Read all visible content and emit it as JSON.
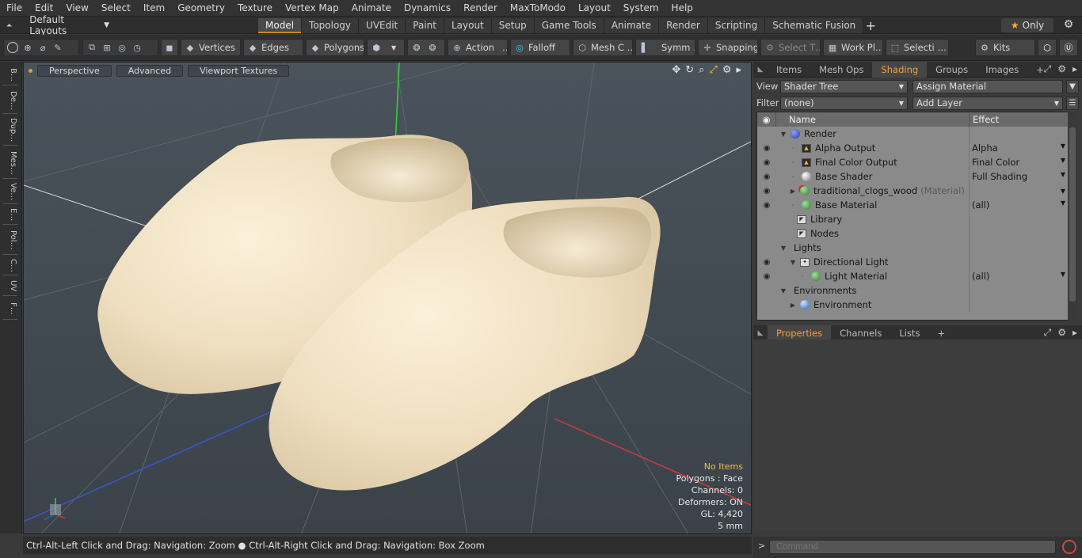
{
  "menu": [
    "File",
    "Edit",
    "View",
    "Select",
    "Item",
    "Geometry",
    "Texture",
    "Vertex Map",
    "Animate",
    "Dynamics",
    "Render",
    "MaxToModo",
    "Layout",
    "System",
    "Help"
  ],
  "layout_select": "Default Layouts",
  "tabs": [
    "Model",
    "Topology",
    "UVEdit",
    "Paint",
    "Layout",
    "Setup",
    "Game Tools",
    "Animate",
    "Render",
    "Scripting",
    "Schematic Fusion"
  ],
  "tab_add": "+",
  "only_label": "Only",
  "toolbar": {
    "vertices": "Vertices",
    "edges": "Edges",
    "polygons": "Polygons",
    "action": "Action",
    "action_more": "…",
    "falloff": "Falloff",
    "mesh": "Mesh C …",
    "symm": "Symm …",
    "snapping": "Snapping",
    "select_t": "Select T…",
    "work_pl": "Work Pl…",
    "selecti": "Selecti …",
    "kits": "Kits"
  },
  "left_tabs": [
    "B…",
    "De…",
    "Dup…",
    "Mes…",
    "Ve…",
    "E…",
    "Pol…",
    "C…",
    "UV",
    "F…"
  ],
  "viewport": {
    "perspective": "Perspective",
    "advanced": "Advanced",
    "textures": "Viewport Textures",
    "info": {
      "no_items": "No Items",
      "polygons": "Polygons : Face",
      "channels": "Channels: 0",
      "deformers": "Deformers: ON",
      "gl": "GL: 4,420",
      "scale": "5 mm"
    }
  },
  "status": {
    "hint1": "Ctrl-Alt-Left Click and Drag: Navigation: Zoom",
    "hint2": "Ctrl-Alt-Right Click and Drag: Navigation: Box Zoom"
  },
  "panel_tabs": [
    "Items",
    "Mesh Ops",
    "Shading",
    "Groups",
    "Images"
  ],
  "panel_add": "+",
  "view_label": "View",
  "view_value": "Shader Tree",
  "assign_material": "Assign Material",
  "filter_label": "Filter",
  "filter_value": "(none)",
  "add_layer": "Add Layer",
  "tree": {
    "col_name": "Name",
    "col_effect": "Effect",
    "rows": [
      {
        "name": "Render",
        "effect": "",
        "suffix": ""
      },
      {
        "name": "Alpha Output",
        "effect": "Alpha",
        "suffix": ""
      },
      {
        "name": "Final Color Output",
        "effect": "Final Color",
        "suffix": ""
      },
      {
        "name": "Base Shader",
        "effect": "Full Shading",
        "suffix": ""
      },
      {
        "name": "traditional_clogs_wood",
        "effect": "",
        "suffix": "(Material)"
      },
      {
        "name": "Base Material",
        "effect": "(all)",
        "suffix": ""
      },
      {
        "name": "Library",
        "effect": "",
        "suffix": ""
      },
      {
        "name": "Nodes",
        "effect": "",
        "suffix": ""
      },
      {
        "name": "Lights",
        "effect": "",
        "suffix": ""
      },
      {
        "name": "Directional Light",
        "effect": "",
        "suffix": ""
      },
      {
        "name": "Light Material",
        "effect": "(all)",
        "suffix": ""
      },
      {
        "name": "Environments",
        "effect": "",
        "suffix": ""
      },
      {
        "name": "Environment",
        "effect": "",
        "suffix": ""
      }
    ]
  },
  "props_tabs": [
    "Properties",
    "Channels",
    "Lists"
  ],
  "props_add": "+",
  "command_placeholder": "Command",
  "colors": {
    "accent": "#f2a134",
    "viewport_bg": "#444c53",
    "clog": "#f4e6cc",
    "axis_x": "#d03030",
    "axis_y": "#30c030",
    "axis_z": "#3050d0"
  }
}
